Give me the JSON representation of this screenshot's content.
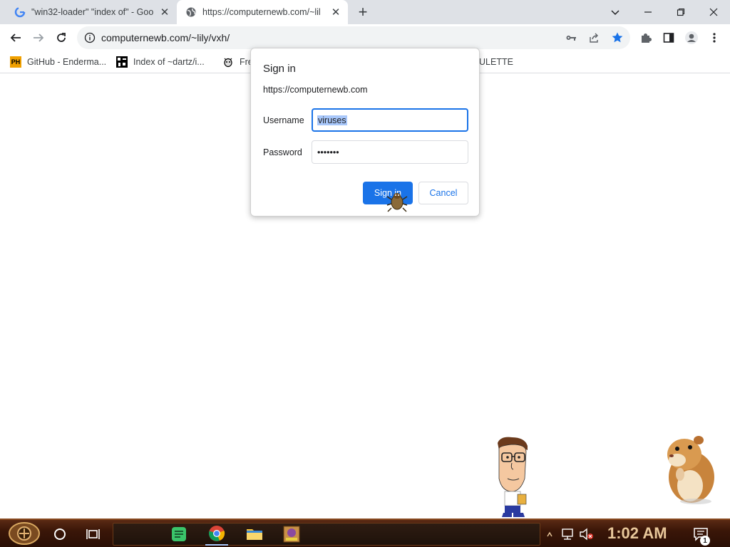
{
  "browser": {
    "tabs": [
      {
        "title": "\"win32-loader\" \"index of\" - Goo",
        "favicon": "google-g-icon",
        "active": false
      },
      {
        "title": "https://computernewb.com/~lil",
        "favicon": "globe-icon",
        "active": true
      }
    ],
    "new_tab_label": "+",
    "address_bar": {
      "url": "computernewb.com/~lily/vxh/"
    }
  },
  "bookmarks": [
    {
      "label": "GitHub - Enderma...",
      "icon": "ph-icon",
      "icon_text": "PH"
    },
    {
      "label": "Index of ~dartz/i...",
      "icon": "bmp-grid-icon"
    },
    {
      "label": "Fre",
      "icon": "bug-icon"
    },
    {
      "label": "ULETTE",
      "icon": ""
    }
  ],
  "dialog": {
    "title": "Sign in",
    "origin": "https://computernewb.com",
    "username_label": "Username",
    "username_value": "viruses",
    "password_label": "Password",
    "password_value": "•••••••",
    "sign_in_button": "Sign in",
    "cancel_button": "Cancel"
  },
  "taskbar": {
    "clock": "1:02 AM",
    "notification_count": "1"
  },
  "colors": {
    "accent": "#1a73e8",
    "tabstrip_bg": "#dee1e6",
    "taskbar_bg": "#3a1608"
  }
}
